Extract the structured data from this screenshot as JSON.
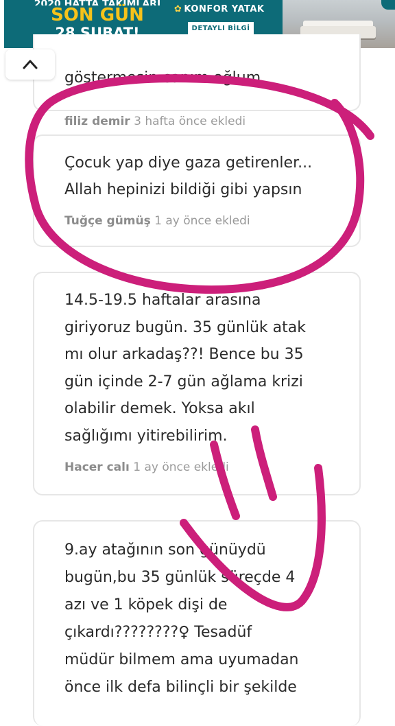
{
  "ad": {
    "top_text": "2020 HATTA TAKIMLARI",
    "headline": "SON GÜN",
    "date": "28 ŞUBAT!",
    "brand": "KONFOR YATAK",
    "cta": "DETAYLI BİLGİ",
    "colors": {
      "background": "#0d6b78",
      "headline": "#f6c21b"
    }
  },
  "collapse_button": {
    "icon": "chevron-up-icon"
  },
  "comments": [
    {
      "text": "göstermesin canım oğlum",
      "author": "filiz demir",
      "time": "3 hafta önce ekledi"
    },
    {
      "lines": [
        "Çocuk yap diye gaza getirenler...",
        "Allah hepinizi bildiği gibi yapsın"
      ],
      "author": "Tuğçe gümüş",
      "time": "1 ay önce ekledi"
    },
    {
      "lines": [
        "14.5-19.5 haftalar arasına",
        "giriyoruz bugün. 35 günlük atak",
        "mı olur arkadaş??! Bence bu 35",
        "gün içinde 2-7 gün ağlama krizi",
        "olabilir demek. Yoksa akıl",
        "sağlığımı yitirebilirim."
      ],
      "author": "Hacer calı",
      "time": "1 ay önce ekledi"
    },
    {
      "lines": [
        "9.ay atağının son günüydü",
        "bugün,bu 35 günlük süreçde 4",
        "azı ve 1 köpek dişi de",
        "çıkardı????????♀ Tesadüf",
        "müdür bilmem ama uyumadan",
        "önce ilk defa bilinçli bir şekilde"
      ]
    }
  ],
  "annotation": {
    "color": "#cc1f7a"
  }
}
